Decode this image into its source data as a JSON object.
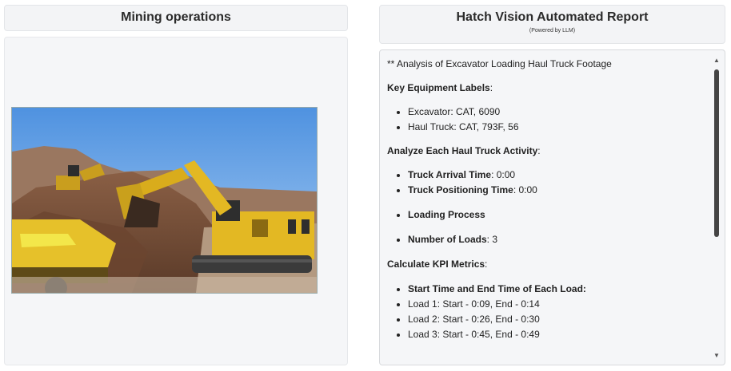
{
  "left": {
    "title": "Mining operations",
    "video_alt": "Excavator loading haul truck footage"
  },
  "right": {
    "title": "Hatch Vision Automated Report",
    "subtitle": "(Powered by LLM)"
  },
  "report": {
    "intro": "** Analysis of Excavator Loading Haul Truck Footage",
    "equipment_heading": "Key Equipment Labels",
    "equipment": [
      "Excavator: CAT, 6090",
      "Haul Truck: CAT, 793F, 56"
    ],
    "activity_heading": "Analyze Each Haul Truck Activity",
    "arrival_label": "Truck Arrival Time",
    "arrival_value": ": 0:00",
    "positioning_label": "Truck Positioning Time",
    "positioning_value": ": 0:00",
    "loading_process_label": "Loading Process",
    "num_loads_label": "Number of Loads",
    "num_loads_value": ": 3",
    "kpi_heading": "Calculate KPI Metrics",
    "times_label": "Start Time and End Time of Each Load:",
    "loads": [
      "Load 1: Start - 0:09, End - 0:14",
      "Load 2: Start - 0:26, End - 0:30",
      "Load 3: Start - 0:45, End - 0:49"
    ]
  },
  "colors": {
    "panel_bg": "#f5f6f8",
    "scroll_thumb": "#444444",
    "sky": "#6fa7e6",
    "machine_yellow": "#e3b823"
  },
  "icons": {
    "scroll_up": "triangle-up",
    "scroll_down": "triangle-down"
  }
}
